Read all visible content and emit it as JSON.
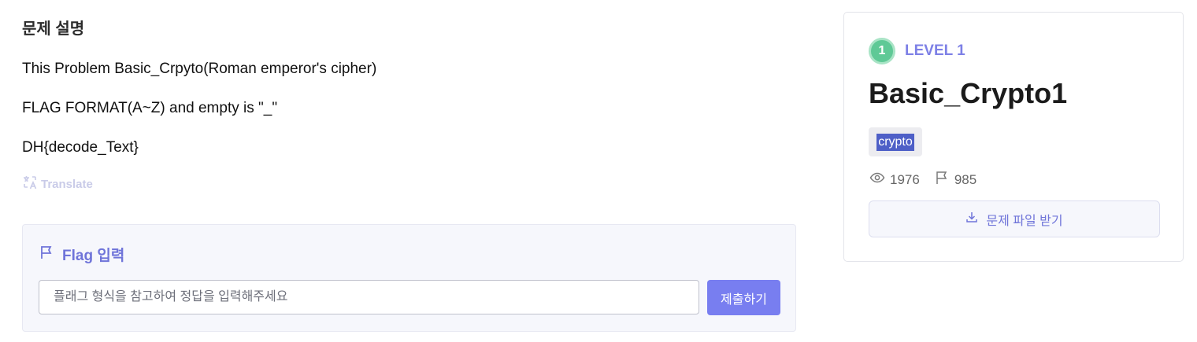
{
  "description": {
    "title": "문제 설명",
    "lines": [
      "This Problem Basic_Crpyto(Roman emperor's cipher)",
      "FLAG FORMAT(A~Z) and empty is \"_\"",
      "DH{decode_Text}"
    ],
    "translate_label": "Translate"
  },
  "flag_form": {
    "title": "Flag 입력",
    "input_placeholder": "플래그 형식을 참고하여 정답을 입력해주세요",
    "input_value": "",
    "submit_label": "제출하기"
  },
  "challenge": {
    "level_number": "1",
    "level_label": "LEVEL 1",
    "title": "Basic_Crypto1",
    "tag": "crypto",
    "views": "1976",
    "solves": "985",
    "download_label": "문제 파일 받기"
  },
  "colors": {
    "accent": "#787ef0",
    "level_green": "#5fc996",
    "tag_highlight": "#4e5fc7"
  }
}
